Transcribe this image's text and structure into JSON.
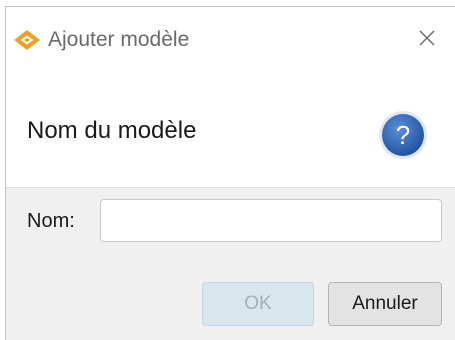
{
  "window": {
    "title": "Ajouter modèle",
    "app_icon": "diamond-logo-icon",
    "close_icon": "close-icon"
  },
  "header": {
    "title": "Nom du modèle",
    "help_icon": "help-icon",
    "help_glyph": "?"
  },
  "form": {
    "name_label": "Nom:",
    "name_value": "",
    "name_placeholder": ""
  },
  "buttons": {
    "ok_label": "OK",
    "cancel_label": "Annuler"
  },
  "colors": {
    "logo_orange": "#f0a020",
    "help_blue": "#2a63b8",
    "ok_disabled_bg": "#d8e6ee",
    "body_bg": "#f0f0f0"
  }
}
